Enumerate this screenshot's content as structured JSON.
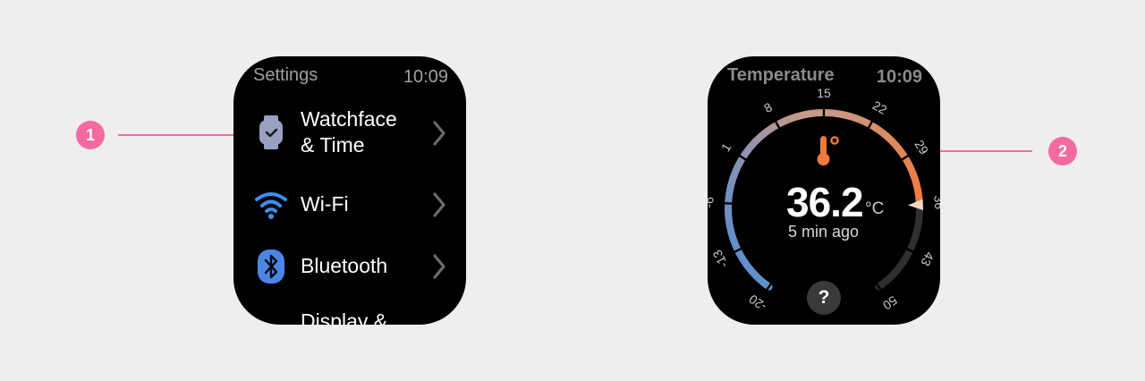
{
  "settings_screen": {
    "title": "Settings",
    "time": "10:09",
    "items": [
      {
        "label_line1": "Watchface",
        "label_line2": "& Time",
        "icon": "watch-icon"
      },
      {
        "label": "Wi-Fi",
        "icon": "wifi-icon"
      },
      {
        "label": "Bluetooth",
        "icon": "bluetooth-icon"
      },
      {
        "label": "Display &",
        "icon": "display-icon"
      }
    ]
  },
  "temperature_screen": {
    "title": "Temperature",
    "time": "10:09",
    "value": "36.2",
    "unit": "°C",
    "ago": "5 min ago",
    "help": "?",
    "scale_ticks": [
      "-20",
      "-13",
      "-6",
      "1",
      "8",
      "15",
      "22",
      "29",
      "36",
      "43",
      "50"
    ],
    "scale_min": -20,
    "scale_max": 50,
    "current": 36.2
  },
  "callouts": [
    "1",
    "2"
  ],
  "colors": {
    "accent_pink": "#f46aa0",
    "wifi_blue": "#3d8ef0",
    "bluetooth_blue": "#4a86e8",
    "temp_orange": "#f07a3a",
    "cold_blue": "#4f8fd4"
  }
}
